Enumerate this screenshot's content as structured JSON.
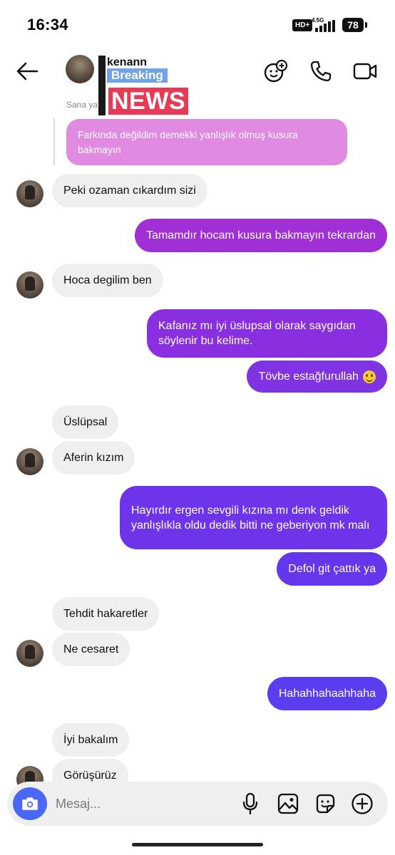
{
  "status_bar": {
    "time": "16:34",
    "hd": "HD+",
    "network": "4.5G",
    "battery": "78"
  },
  "header": {
    "username": "kenann",
    "overlay": {
      "line1": "Breaking",
      "line2": "NEWS"
    }
  },
  "reply_preview": {
    "label": "Sana ya",
    "text": "Farkında değildim demekki yanlışlık olmuş kusura bakmayın",
    "color": "#e08ae2"
  },
  "messages": [
    {
      "dir": "in",
      "text": "Peki ozaman cıkardım sizi"
    },
    {
      "dir": "out",
      "text": "Tamamdır hocam kusura bakmayın tekrardan",
      "color": "#a02fd6"
    },
    {
      "dir": "in",
      "text": "Hoca degilim ben"
    },
    {
      "dir": "out",
      "text": "Kafanız mı iyi üslupsal olarak saygıdan söylenir bu kelime.",
      "color": "#8a2fe0"
    },
    {
      "dir": "out",
      "text": "Tövbe estağfurullah",
      "emoji": "grinning-face-emoji",
      "color": "#8033e2"
    },
    {
      "dir": "in",
      "text": "Üslüpsal"
    },
    {
      "dir": "in",
      "text": "Aferin kızım"
    },
    {
      "dir": "out",
      "text": "Hayırdır ergen sevgili kızına mı denk geldik yanlışlıkla oldu dedik bitti ne geberiyon mk malı",
      "color": "#6e34ea"
    },
    {
      "dir": "out",
      "text": "Defol git çattık ya",
      "color": "#6436ec"
    },
    {
      "dir": "in",
      "text": "Tehdit hakaretler"
    },
    {
      "dir": "in",
      "text": "Ne cesaret"
    },
    {
      "dir": "out",
      "text": "Hahahhahaahhaha",
      "color": "#5b3df0"
    },
    {
      "dir": "in",
      "text": "İyi bakalım"
    },
    {
      "dir": "in",
      "text": "Görüşürüz"
    }
  ],
  "composer": {
    "placeholder": "Mesaj...",
    "camera_color": "#4a67f5"
  },
  "icons": [
    "back-arrow-icon",
    "add-emoji-icon",
    "phone-icon",
    "video-call-icon",
    "camera-icon",
    "microphone-icon",
    "gallery-icon",
    "sticker-icon",
    "plus-circle-icon"
  ]
}
